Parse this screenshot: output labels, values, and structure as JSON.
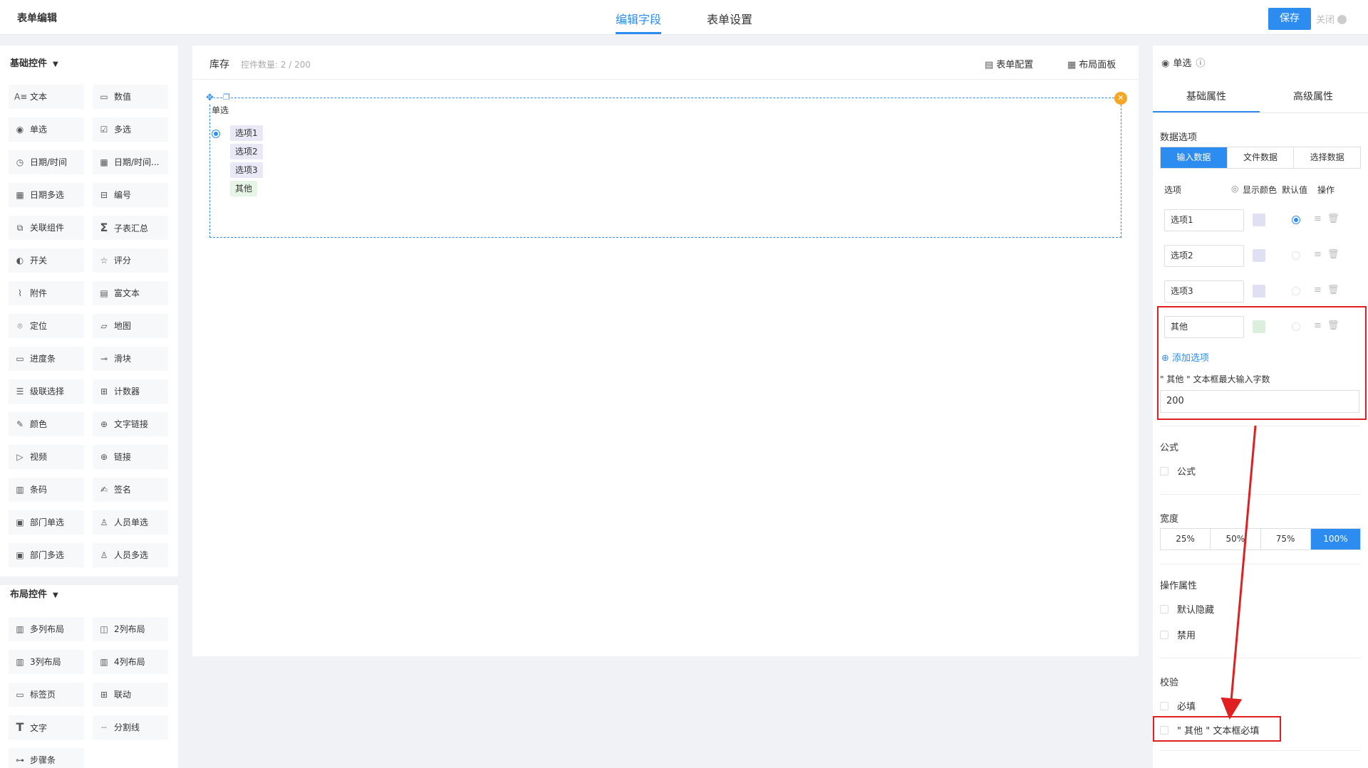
{
  "app": {
    "title": "表单编辑"
  },
  "top_tabs": [
    {
      "label": "编辑字段"
    },
    {
      "label": "表单设置"
    }
  ],
  "actions": {
    "save": "保存",
    "close": "关闭"
  },
  "left": {
    "basic_group": "基础控件",
    "basic_items": [
      {
        "label": "文本",
        "icon": "text-icon"
      },
      {
        "label": "数值",
        "icon": "number-icon"
      },
      {
        "label": "单选",
        "icon": "radio-icon"
      },
      {
        "label": "多选",
        "icon": "checkbox-icon"
      },
      {
        "label": "日期/时间",
        "icon": "clock-icon"
      },
      {
        "label": "日期/时间...",
        "icon": "calendar-icon"
      },
      {
        "label": "日期多选",
        "icon": "calendar-multi-icon"
      },
      {
        "label": "编号",
        "icon": "serial-icon"
      },
      {
        "label": "关联组件",
        "icon": "link-component-icon"
      },
      {
        "label": "子表汇总",
        "icon": "sigma-icon"
      },
      {
        "label": "开关",
        "icon": "toggle-icon"
      },
      {
        "label": "评分",
        "icon": "star-icon"
      },
      {
        "label": "附件",
        "icon": "paperclip-icon"
      },
      {
        "label": "富文本",
        "icon": "rich-text-icon"
      },
      {
        "label": "定位",
        "icon": "location-pin-icon"
      },
      {
        "label": "地图",
        "icon": "map-icon"
      },
      {
        "label": "进度条",
        "icon": "progress-icon"
      },
      {
        "label": "滑块",
        "icon": "slider-icon"
      },
      {
        "label": "级联选择",
        "icon": "cascade-icon"
      },
      {
        "label": "计数器",
        "icon": "counter-icon"
      },
      {
        "label": "颜色",
        "icon": "eyedropper-icon"
      },
      {
        "label": "文字链接",
        "icon": "globe-icon"
      },
      {
        "label": "视频",
        "icon": "video-icon"
      },
      {
        "label": "链接",
        "icon": "globe-link-icon"
      },
      {
        "label": "条码",
        "icon": "barcode-icon"
      },
      {
        "label": "签名",
        "icon": "signature-icon"
      },
      {
        "label": "部门单选",
        "icon": "department-icon"
      },
      {
        "label": "人员单选",
        "icon": "user-icon"
      },
      {
        "label": "部门多选",
        "icon": "department-multi-icon"
      },
      {
        "label": "人员多选",
        "icon": "users-icon"
      }
    ],
    "layout_group": "布局控件",
    "layout_items": [
      {
        "label": "多列布局",
        "icon": "multi-column-icon"
      },
      {
        "label": "2列布局",
        "icon": "two-column-icon"
      },
      {
        "label": "3列布局",
        "icon": "three-column-icon"
      },
      {
        "label": "4列布局",
        "icon": "four-column-icon"
      },
      {
        "label": "标签页",
        "icon": "tabs-icon"
      },
      {
        "label": "联动",
        "icon": "grid-link-icon"
      },
      {
        "label": "文字",
        "icon": "big-t-icon"
      },
      {
        "label": "分割线",
        "icon": "divider-icon"
      },
      {
        "label": "步骤条",
        "icon": "steps-icon"
      }
    ]
  },
  "canvas": {
    "title": "库存",
    "count_label": "控件数量: 2 / 200",
    "form_config": "表单配置",
    "layout_panel": "布局面板",
    "field": {
      "label": "单选",
      "options": [
        "选项1",
        "选项2",
        "选项3",
        "其他"
      ]
    }
  },
  "right": {
    "title": "单选",
    "tabs": [
      "基础属性",
      "高级属性"
    ],
    "data_options_title": "数据选项",
    "data_source": [
      "输入数据",
      "文件数据",
      "选择数据"
    ],
    "option_cols": {
      "option": "选项",
      "show_color": "显示颜色",
      "default": "默认值",
      "action": "操作"
    },
    "options": [
      "选项1",
      "选项2",
      "选项3",
      "其他"
    ],
    "add_option": "添加选项",
    "other_max_label": "\" 其他 \" 文本框最大输入字数",
    "other_max_value": "200",
    "formula_title": "公式",
    "formula_check": "公式",
    "width_title": "宽度",
    "width_options": [
      "25%",
      "50%",
      "75%",
      "100%"
    ],
    "op_title": "操作属性",
    "op_hidden": "默认隐藏",
    "op_disabled": "禁用",
    "validate_title": "校验",
    "required": "必填",
    "other_required": "\" 其他 \" 文本框必填"
  },
  "colors": {
    "accent": "#2d8cf0",
    "annotation": "#e02020",
    "delete": "#f5a623"
  }
}
